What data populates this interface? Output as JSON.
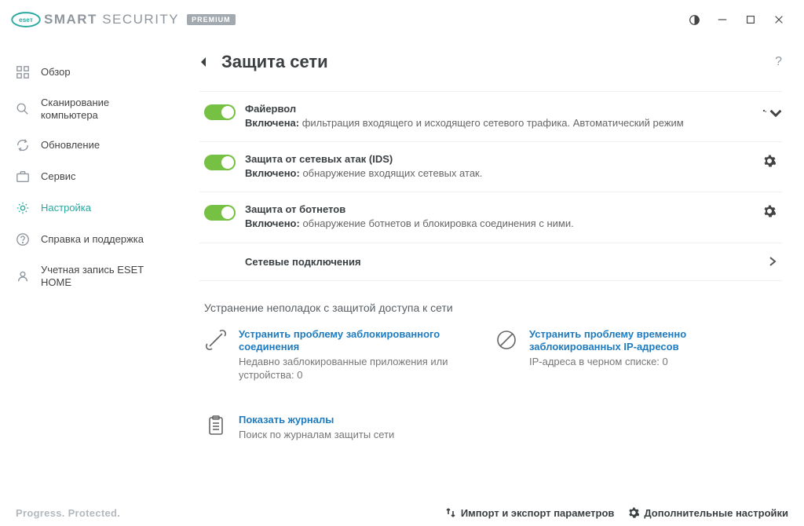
{
  "window": {
    "brand": "SMART",
    "brand_sub": "SECURITY",
    "premium": "PREMIUM"
  },
  "sidebar": {
    "items": [
      {
        "label": "Обзор"
      },
      {
        "label": "Сканирование компьютера"
      },
      {
        "label": "Обновление"
      },
      {
        "label": "Сервис"
      },
      {
        "label": "Настройка"
      },
      {
        "label": "Справка и поддержка"
      },
      {
        "label": "Учетная запись ESET HOME"
      }
    ]
  },
  "page": {
    "title": "Защита сети",
    "help": "?"
  },
  "options": [
    {
      "title": "Файервол",
      "status": "Включена:",
      "desc": " фильтрация входящего и исходящего сетевого трафика. Автоматический режим"
    },
    {
      "title": "Защита от сетевых атак (IDS)",
      "status": "Включено:",
      "desc": " обнаружение входящих сетевых атак."
    },
    {
      "title": "Защита от ботнетов",
      "status": "Включено:",
      "desc": " обнаружение ботнетов и блокировка соединения с ними."
    }
  ],
  "network_link": "Сетевые подключения",
  "troubleshoot_title": "Устранение неполадок с защитой доступа к сети",
  "cards": [
    {
      "title": "Устранить проблему заблокированного соединения",
      "desc": "Недавно заблокированные приложения или устройства: 0"
    },
    {
      "title": "Устранить проблему временно заблокированных IP-адресов",
      "desc": "IP-адреса в черном списке: 0"
    },
    {
      "title": "Показать журналы",
      "desc": "Поиск по журналам защиты сети"
    }
  ],
  "footer": {
    "tagline": "Progress. Protected.",
    "import_export": "Импорт и экспорт параметров",
    "advanced": "Дополнительные настройки"
  }
}
